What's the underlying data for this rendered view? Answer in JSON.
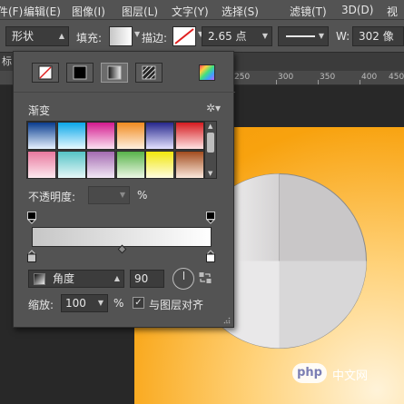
{
  "menubar": {
    "items": [
      "件(F)",
      "编辑(E)",
      "图像(I)",
      "图层(L)",
      "文字(Y)",
      "选择(S)",
      "滤镜(T)",
      "3D(D)",
      "视"
    ]
  },
  "options_bar": {
    "shape_mode": "形状",
    "fill_label": "填充:",
    "stroke_label": "描边:",
    "stroke_width": "2.65 点",
    "width_label": "W:",
    "width_value": "302 像"
  },
  "canvas": {
    "tab_corner": "标",
    "ruler_numbers": [
      "250",
      "300",
      "350",
      "400",
      "450"
    ],
    "pie_base_color": "#c9c7c8",
    "background_gradient_colors": [
      "#f49a0a",
      "#ffd27a",
      "#fff3d9"
    ]
  },
  "gradient_panel": {
    "fill_type_tabs": [
      "no-fill",
      "solid-color",
      "gradient",
      "pattern"
    ],
    "active_tab": "gradient",
    "section_title": "渐变",
    "presets_row1": [
      [
        "#0a3d8f",
        "#e8f3ff"
      ],
      [
        "#0aa6e8",
        "#e9fbff"
      ],
      [
        "#d31a8e",
        "#fbe3f2"
      ],
      [
        "#f08a1f",
        "#fff1e0"
      ],
      [
        "#27288c",
        "#e4e2ff"
      ],
      [
        "#d41b1f",
        "#ffe3e3"
      ]
    ],
    "presets_row2": [
      [
        "#e8789e",
        "#fde9ef"
      ],
      [
        "#55c3c6",
        "#e6f8f8"
      ],
      [
        "#a46bb1",
        "#f3e9f6"
      ],
      [
        "#58b34a",
        "#edf8e6"
      ],
      [
        "#f0e60c",
        "#fffde0"
      ],
      [
        "#a24c1e",
        "#fbe8dc"
      ]
    ],
    "opacity_label": "不透明度:",
    "opacity_value": "",
    "opacity_unit": "%",
    "gradient_start": "#c6c6c6",
    "gradient_end": "#ffffff",
    "style_label": "角度",
    "angle_value": "90",
    "scale_label": "缩放:",
    "scale_value": "100",
    "scale_unit": "%",
    "align_checked": true,
    "align_label": "与图层对齐"
  },
  "watermark": {
    "logo_text": "php",
    "site_text": "中文网"
  }
}
